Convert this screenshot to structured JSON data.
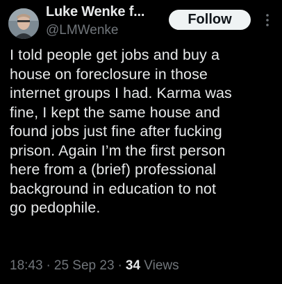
{
  "author": {
    "display_name": "Luke Wenke f...",
    "handle": "@LMWenke"
  },
  "follow_button": {
    "label": "Follow"
  },
  "more_icon": "vertical-ellipsis-icon",
  "tweet": {
    "text": "I told people get jobs and buy a\nhouse on foreclosure in those\ninternet groups I had. Karma was\nfine, I kept the same house and\nfound jobs just fine after fucking\nprison. Again I’m the first person\nhere from a (brief) professional\nbackground in education to not\ngo pedophile."
  },
  "meta": {
    "time": "18:43",
    "date": "25 Sep 23",
    "views_count": "34",
    "views_label": "Views"
  },
  "colors": {
    "background": "#000000",
    "primary_text": "#e7e9ea",
    "secondary_text": "#71767b",
    "follow_bg": "#eff3f4",
    "follow_text": "#0f1419"
  }
}
